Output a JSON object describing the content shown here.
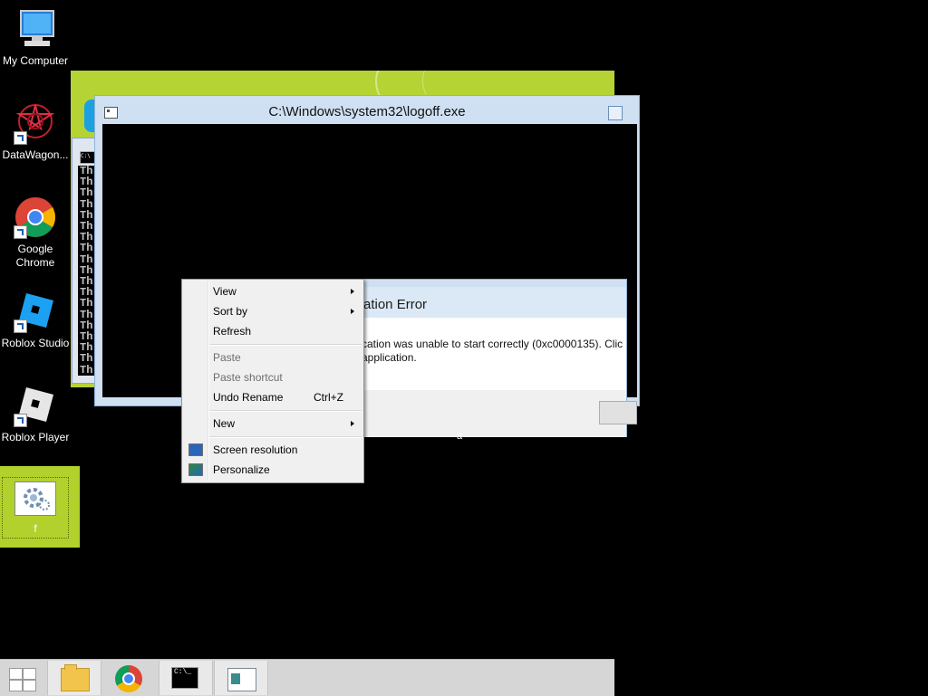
{
  "desktop": {
    "icons": [
      {
        "label": "My Computer",
        "icon": "computer-icon"
      },
      {
        "label": "DataWagon...",
        "icon": "datawagon-icon"
      },
      {
        "label": "Google Chrome",
        "icon": "chrome-icon"
      },
      {
        "label": "Roblox Studio",
        "icon": "roblox-studio-icon"
      },
      {
        "label": "Roblox Player",
        "icon": "roblox-player-icon"
      },
      {
        "label": "f",
        "icon": "settings-app-icon"
      }
    ],
    "stray_text": "a"
  },
  "logoff_window": {
    "title": "C:\\Windows\\system32\\logoff.exe"
  },
  "cmd_window": {
    "lines": [
      "Th",
      "Th",
      "Th",
      "Th",
      "Th",
      "Th",
      "Th",
      "Th",
      "Th",
      "Th",
      "Th",
      "Th",
      "Th",
      "Th",
      "Th",
      "Th",
      "Th",
      "Th",
      "Th"
    ],
    "icon_text": "C:\\"
  },
  "error_dialog": {
    "title": "ation Error",
    "message_line1": "cation was unable to start correctly (0xc0000135). Clic",
    "message_line2": "application."
  },
  "context_menu": {
    "items": [
      {
        "label": "View",
        "submenu": true,
        "disabled": false
      },
      {
        "label": "Sort by",
        "submenu": true,
        "disabled": false
      },
      {
        "label": "Refresh",
        "submenu": false,
        "disabled": false
      },
      {
        "label": "Paste",
        "submenu": false,
        "disabled": true
      },
      {
        "label": "Paste shortcut",
        "submenu": false,
        "disabled": true
      },
      {
        "label": "Undo Rename",
        "shortcut": "Ctrl+Z",
        "submenu": false,
        "disabled": false
      },
      {
        "label": "New",
        "submenu": true,
        "disabled": false
      },
      {
        "label": "Screen resolution",
        "icon": "display-icon",
        "submenu": false,
        "disabled": false
      },
      {
        "label": "Personalize",
        "icon": "personalize-icon",
        "submenu": false,
        "disabled": false
      }
    ]
  },
  "taskbar": {
    "buttons": [
      {
        "name": "start-button",
        "icon": "windows-logo-icon"
      },
      {
        "name": "file-explorer",
        "icon": "folder-icon"
      },
      {
        "name": "google-chrome",
        "icon": "chrome-icon"
      },
      {
        "name": "command-prompt",
        "icon": "cmd-icon",
        "icon_text": "C:\\_"
      },
      {
        "name": "app-window",
        "icon": "app-window-icon"
      }
    ]
  },
  "colors": {
    "accent_green": "#b5d334",
    "window_frame": "#cfe0f2",
    "menu_bg": "#f0f0f0"
  }
}
